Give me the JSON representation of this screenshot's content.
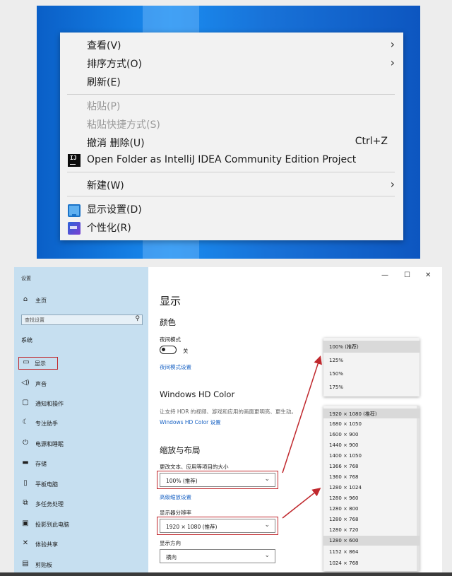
{
  "context_menu": {
    "items": [
      {
        "label": "查看(V)",
        "submenu": true
      },
      {
        "label": "排序方式(O)",
        "submenu": true
      },
      {
        "label": "刷新(E)"
      },
      {
        "label": "粘贴(P)",
        "disabled": true
      },
      {
        "label": "粘贴快捷方式(S)",
        "disabled": true
      },
      {
        "label": "撤消 删除(U)",
        "shortcut": "Ctrl+Z"
      },
      {
        "label": "Open Folder as IntelliJ IDEA Community Edition Project",
        "icon": "intellij-icon",
        "icon_text": "IJ"
      },
      {
        "label": "新建(W)",
        "submenu": true
      },
      {
        "label": "显示设置(D)",
        "icon": "display-settings-icon"
      },
      {
        "label": "个性化(R)",
        "icon": "personalize-icon"
      }
    ],
    "arrow_glyph": "›"
  },
  "settings": {
    "window_title": "设置",
    "window_controls": {
      "minimize": "—",
      "maximize": "☐",
      "close": "✕"
    },
    "sidebar": {
      "home": "主页",
      "search_placeholder": "查找设置",
      "section": "系统",
      "items": [
        {
          "label": "显示",
          "icon": "monitor-icon",
          "selected": true
        },
        {
          "label": "声音",
          "icon": "speaker-icon"
        },
        {
          "label": "通知和操作",
          "icon": "notification-icon"
        },
        {
          "label": "专注助手",
          "icon": "moon-icon"
        },
        {
          "label": "电源和睡眠",
          "icon": "power-icon"
        },
        {
          "label": "存储",
          "icon": "storage-icon"
        },
        {
          "label": "平板电脑",
          "icon": "tablet-icon"
        },
        {
          "label": "多任务处理",
          "icon": "multitask-icon"
        },
        {
          "label": "投影到此电脑",
          "icon": "project-icon"
        },
        {
          "label": "体验共享",
          "icon": "share-icon"
        },
        {
          "label": "剪贴板",
          "icon": "clipboard-icon"
        }
      ]
    },
    "main": {
      "title": "显示",
      "color_heading": "颜色",
      "night_mode_label": "夜间模式",
      "night_mode_state": "关",
      "night_mode_link": "夜间模式设置",
      "hdr_heading": "Windows HD Color",
      "hdr_desc": "让支持 HDR 的视频、游戏和应用的画面更明亮、更生动。",
      "hdr_link": "Windows HD Color 设置",
      "layout_heading": "缩放与布局",
      "scale_label": "更改文本、应用等项目的大小",
      "scale_value": "100% (推荐)",
      "advanced_link": "高级缩放设置",
      "resolution_label": "显示器分辨率",
      "resolution_value": "1920 × 1080 (推荐)",
      "orientation_label": "显示方向",
      "orientation_value": "横向"
    },
    "scale_options": [
      "100% (推荐)",
      "125%",
      "150%",
      "175%"
    ],
    "resolution_options": [
      "1920 × 1080 (推荐)",
      "1680 × 1050",
      "1600 × 900",
      "1440 × 900",
      "1400 × 1050",
      "1366 × 768",
      "1360 × 768",
      "1280 × 1024",
      "1280 × 960",
      "1280 × 800",
      "1280 × 768",
      "1280 × 720",
      "1280 × 600",
      "1152 × 864",
      "1024 × 768"
    ]
  },
  "colors": {
    "accent": "#1a63c4",
    "annotation_red": "#c0282d",
    "sidebar_bg": "#c6dff0"
  }
}
